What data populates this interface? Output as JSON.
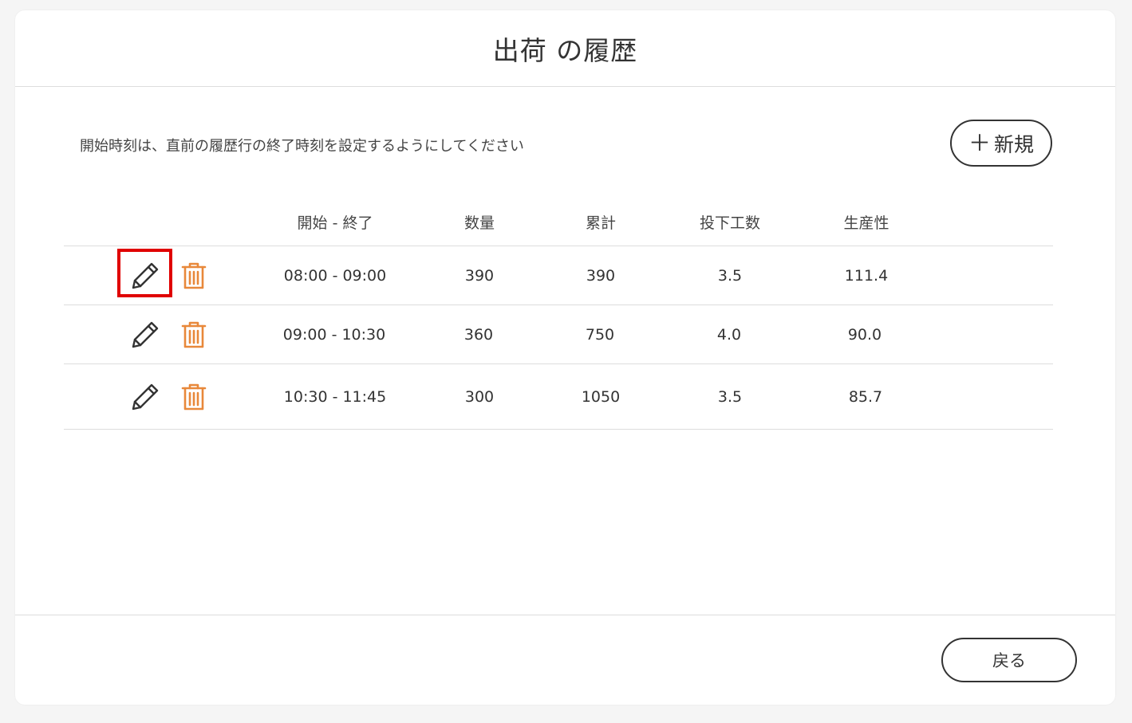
{
  "dialog": {
    "title": "出荷 の履歴",
    "notice": "開始時刻は、直前の履歴行の終了時刻を設定するようにしてください",
    "new_button": {
      "icon": "plus-icon",
      "label": "新規"
    },
    "back_button_label": "戻る"
  },
  "table": {
    "headers": [
      "開始 - 終了",
      "数量",
      "累計",
      "投下工数",
      "生産性"
    ],
    "rows": [
      {
        "time_range": "08:00 - 09:00",
        "quantity": "390",
        "cumulative": "390",
        "man_hours": "3.5",
        "productivity": "111.4"
      },
      {
        "time_range": "09:00 - 10:30",
        "quantity": "360",
        "cumulative": "750",
        "man_hours": "4.0",
        "productivity": "90.0"
      },
      {
        "time_range": "10:30 - 11:45",
        "quantity": "300",
        "cumulative": "1050",
        "man_hours": "3.5",
        "productivity": "85.7"
      }
    ],
    "row_icons": {
      "edit": "pencil-icon",
      "delete": "trash-icon"
    }
  },
  "colors": {
    "delete_icon": "#e8883a",
    "highlight": "#e00000",
    "text": "#333333",
    "divider": "#dddddd"
  }
}
